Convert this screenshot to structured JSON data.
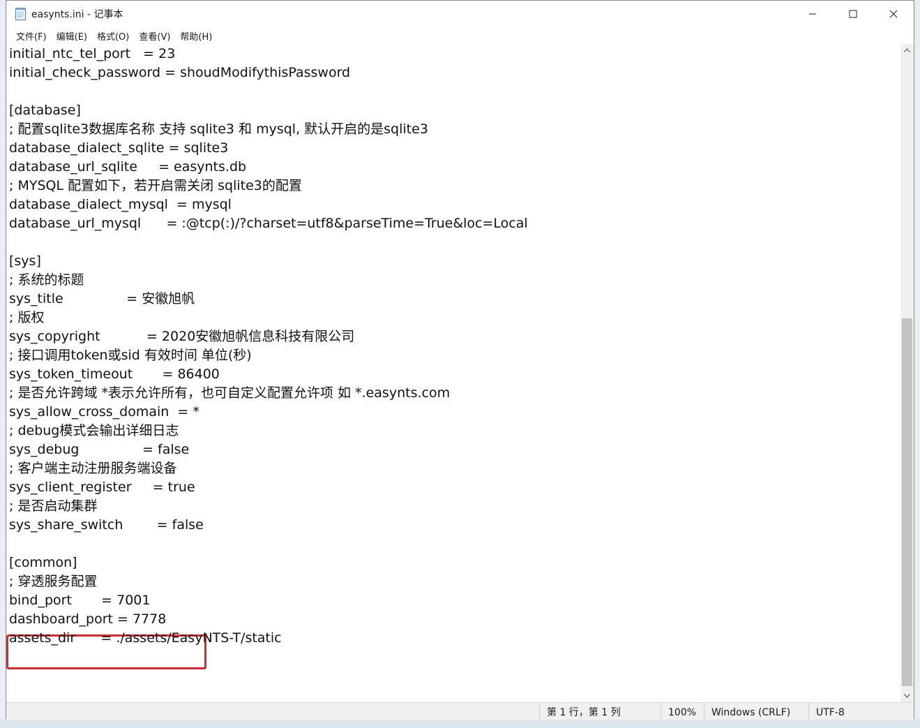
{
  "window": {
    "title": "easynts.ini - 记事本",
    "minimize_icon": "minimize-icon",
    "maximize_icon": "maximize-icon",
    "close_icon": "close-icon"
  },
  "menu": {
    "items": [
      "文件(F)",
      "编辑(E)",
      "格式(O)",
      "查看(V)",
      "帮助(H)"
    ]
  },
  "editor": {
    "lines": [
      "initial_ntc_tel_port   = 23",
      "initial_check_password = shoudModifythisPassword",
      "",
      "[database]",
      "; 配置sqlite3数据库名称 支持 sqlite3 和 mysql, 默认开启的是sqlite3",
      "database_dialect_sqlite = sqlite3",
      "database_url_sqlite     = easynts.db",
      "; MYSQL 配置如下，若开启需关闭 sqlite3的配置",
      "database_dialect_mysql  = mysql",
      "database_url_mysql      = :@tcp(:)/?charset=utf8&parseTime=True&loc=Local",
      "",
      "[sys]",
      "; 系统的标题",
      "sys_title               = 安徽旭帆",
      "; 版权",
      "sys_copyright           = 2020安徽旭帆信息科技有限公司",
      "; 接口调用token或sid 有效时间 单位(秒)",
      "sys_token_timeout       = 86400",
      "; 是否允许跨域 *表示允许所有，也可自定义配置允许项 如 *.easynts.com",
      "sys_allow_cross_domain  = *",
      "; debug模式会输出详细日志",
      "sys_debug               = false",
      "; 客户端主动注册服务端设备",
      "sys_client_register     = true",
      "; 是否启动集群",
      "sys_share_switch        = false",
      "",
      "[common]",
      "; 穿透服务配置",
      "bind_port       = 7001",
      "dashboard_port = 7778",
      "assets_dir      = ./assets/EasyNTS-T/static"
    ]
  },
  "statusbar": {
    "position": "第 1 行，第 1 列",
    "zoom": "100%",
    "line_ending": "Windows (CRLF)",
    "encoding": "UTF-8"
  },
  "colors": {
    "highlight": "#e8242a",
    "scroll_thumb": "#c2c2c2"
  }
}
